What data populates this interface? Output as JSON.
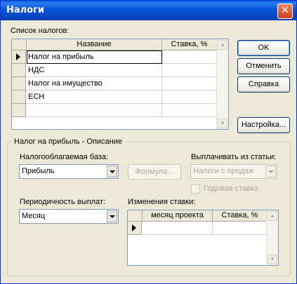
{
  "window": {
    "title": "Налоги",
    "close_glyph": "✕"
  },
  "taxes": {
    "section_label": "Список налогов:",
    "columns": [
      "Название",
      "Ставка, %"
    ],
    "rows": [
      {
        "name": "Налог на прибыль",
        "rate": ""
      },
      {
        "name": "НДС",
        "rate": ""
      },
      {
        "name": "Налог на имущество",
        "rate": ""
      },
      {
        "name": "ЕСН",
        "rate": ""
      },
      {
        "name": "",
        "rate": ""
      }
    ],
    "current_row": 0
  },
  "buttons": {
    "ok": "OK",
    "cancel": "Отменить",
    "help": "Справка",
    "settings": "Настройка...",
    "formula": "Формула..."
  },
  "description": {
    "group_title": "Налог на прибыль - Описание",
    "tax_base_label": "Налогооблагаемая база:",
    "tax_base_value": "Прибыль",
    "pay_from_label": "Выплачивать из статьи:",
    "pay_from_value": "Налоги с продаж",
    "annual_rate_label": "Годовая ставка",
    "annual_rate_checked": false,
    "periodicity_label": "Периодичность выплат:",
    "periodicity_value": "Месяц",
    "rate_changes_label": "Изменения ставки:",
    "rate_changes_columns": [
      "месяц проекта",
      "Ставка, %"
    ]
  }
}
